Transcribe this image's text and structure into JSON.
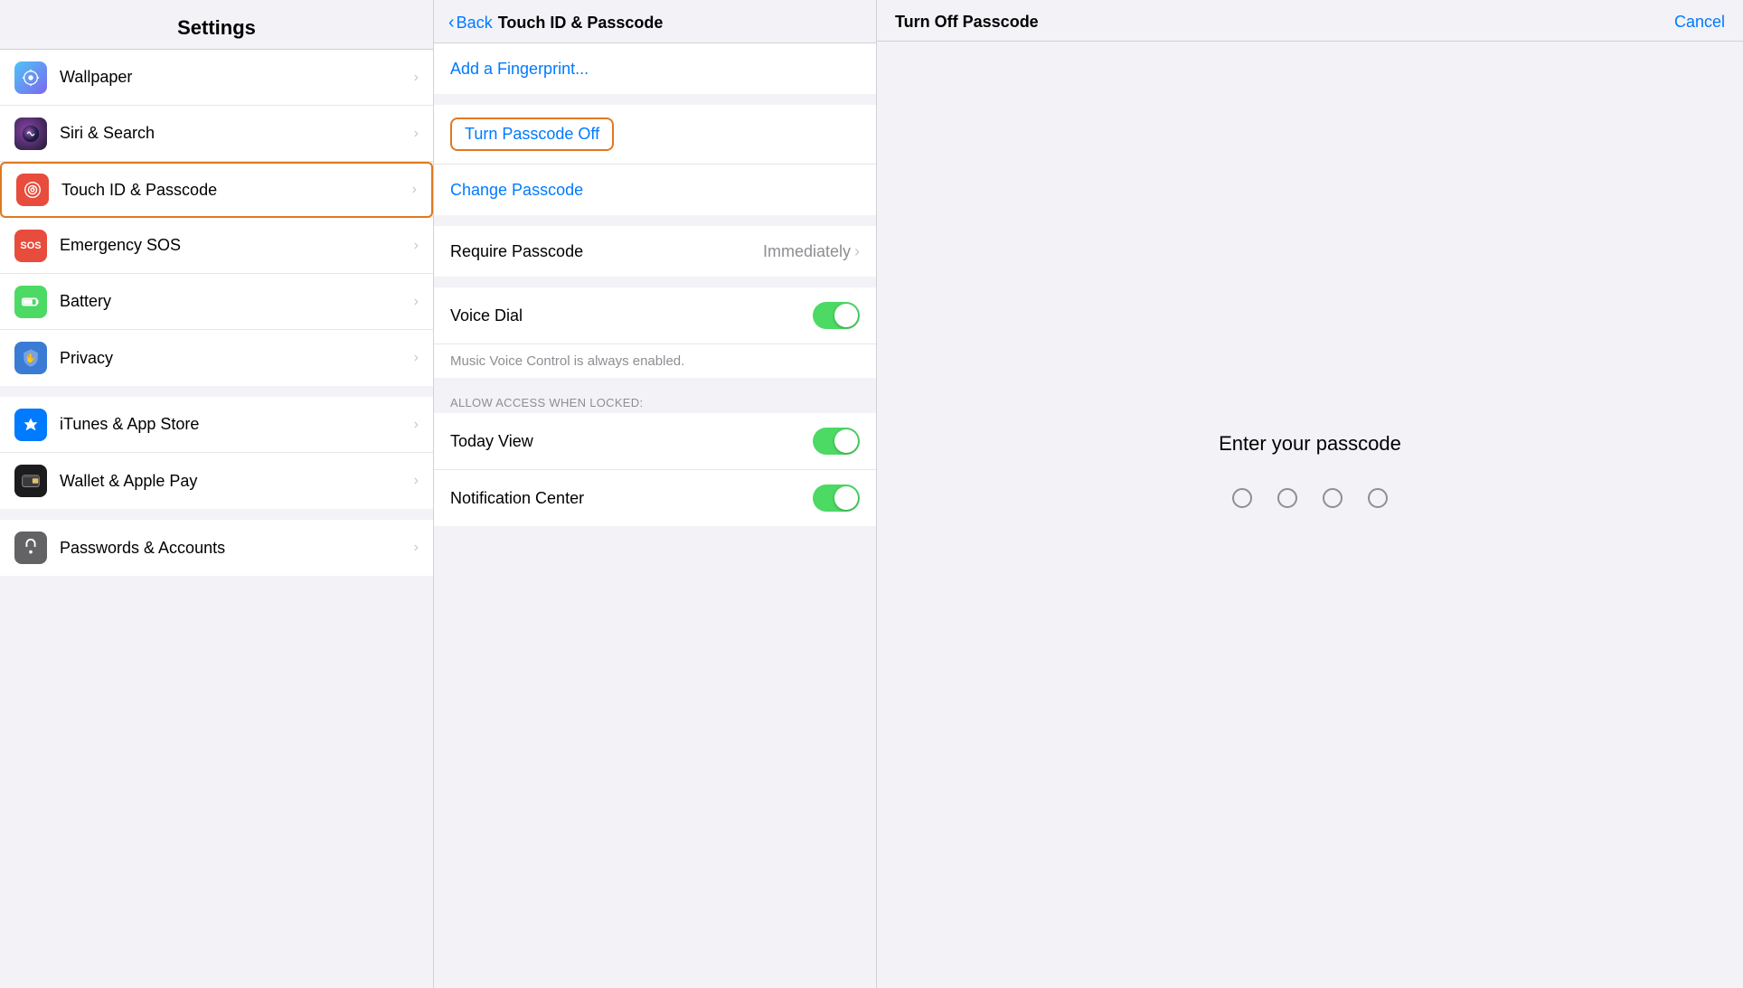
{
  "settings": {
    "title": "Settings",
    "items_group1": [
      {
        "id": "wallpaper",
        "label": "Wallpaper",
        "icon_color": "wallpaper",
        "icon_char": "✿",
        "active": false
      },
      {
        "id": "siri",
        "label": "Siri & Search",
        "icon_color": "siri",
        "icon_char": "◉",
        "active": false
      },
      {
        "id": "touchid",
        "label": "Touch ID & Passcode",
        "icon_color": "touchid",
        "icon_char": "⊛",
        "active": true
      },
      {
        "id": "sos",
        "label": "Emergency SOS",
        "icon_color": "sos",
        "icon_char": "SOS",
        "active": false
      },
      {
        "id": "battery",
        "label": "Battery",
        "icon_color": "battery",
        "icon_char": "▮",
        "active": false
      },
      {
        "id": "privacy",
        "label": "Privacy",
        "icon_color": "privacy",
        "icon_char": "✋",
        "active": false
      }
    ],
    "items_group2": [
      {
        "id": "appstore",
        "label": "iTunes & App Store",
        "icon_color": "appstore",
        "icon_char": "A",
        "active": false
      },
      {
        "id": "wallet",
        "label": "Wallet & Apple Pay",
        "icon_color": "wallet",
        "icon_char": "▤",
        "active": false
      }
    ],
    "items_group3": [
      {
        "id": "passwords",
        "label": "Passwords & Accounts",
        "icon_color": "passwords",
        "icon_char": "🔑",
        "active": false
      }
    ]
  },
  "detail": {
    "back_label": "Back",
    "title": "Touch ID & Passcode",
    "add_fingerprint": "Add a Fingerprint...",
    "turn_passcode_off": "Turn Passcode Off",
    "change_passcode": "Change Passcode",
    "require_passcode_label": "Require Passcode",
    "require_passcode_value": "Immediately",
    "voice_dial_label": "Voice Dial",
    "voice_dial_note": "Music Voice Control is always enabled.",
    "allow_access_label": "ALLOW ACCESS WHEN LOCKED:",
    "today_view_label": "Today View",
    "notification_center_label": "Notification Center"
  },
  "passcode": {
    "title": "Turn Off Passcode",
    "cancel_label": "Cancel",
    "prompt": "Enter your passcode",
    "dots_count": 4
  }
}
